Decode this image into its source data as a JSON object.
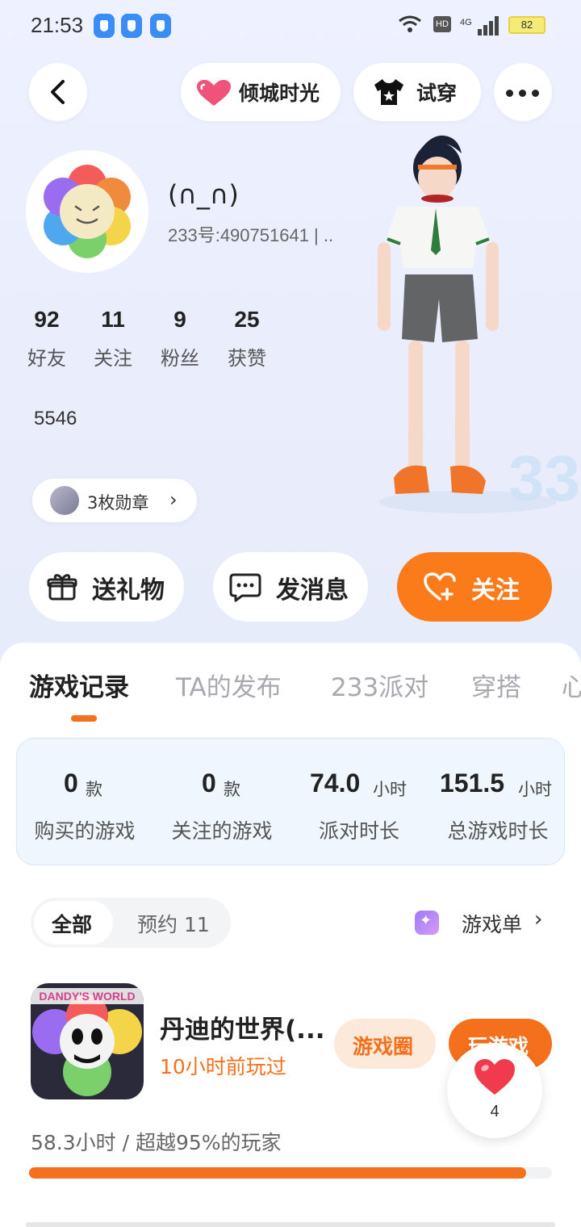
{
  "status_bar": {
    "time": "21:53",
    "hd": "HD",
    "network": "4G",
    "battery": "82"
  },
  "nav": {
    "tag_label": "倾城时光",
    "try_on_label": "试穿"
  },
  "profile": {
    "nickname": "(∩_∩)",
    "uid": "233号:490751641 | ..",
    "bio": "5546",
    "badges_label": "3枚勋章",
    "stats": [
      {
        "num": "92",
        "label": "好友"
      },
      {
        "num": "11",
        "label": "关注"
      },
      {
        "num": "9",
        "label": "粉丝"
      },
      {
        "num": "25",
        "label": "获赞"
      }
    ]
  },
  "actions": {
    "gift": "送礼物",
    "message": "发消息",
    "follow": "关注"
  },
  "tabs": [
    "游戏记录",
    "TA的发布",
    "233派对",
    "穿搭",
    "心"
  ],
  "summary": [
    {
      "num": "0",
      "unit": "款",
      "label": "购买的游戏"
    },
    {
      "num": "0",
      "unit": "款",
      "label": "关注的游戏"
    },
    {
      "num": "74.0",
      "unit": "小时",
      "label": "派对时长"
    },
    {
      "num": "151.5",
      "unit": "小时",
      "label": "总游戏时长"
    }
  ],
  "filter": {
    "all": "全部",
    "reserve": "预约 11",
    "gamelist": "游戏单"
  },
  "game": {
    "icon_text": "DANDY'S WORLD",
    "title": "丹迪的世界(...",
    "last_played": "10小时前玩过",
    "circle_btn": "游戏圈",
    "play_btn": "玩游戏",
    "playtime": "58.3小时 / 超越95%的玩家",
    "progress": 0.95
  },
  "floating_like": {
    "count": "4"
  },
  "colors": {
    "accent": "#f5701c",
    "follow": "#fb7a1a"
  }
}
